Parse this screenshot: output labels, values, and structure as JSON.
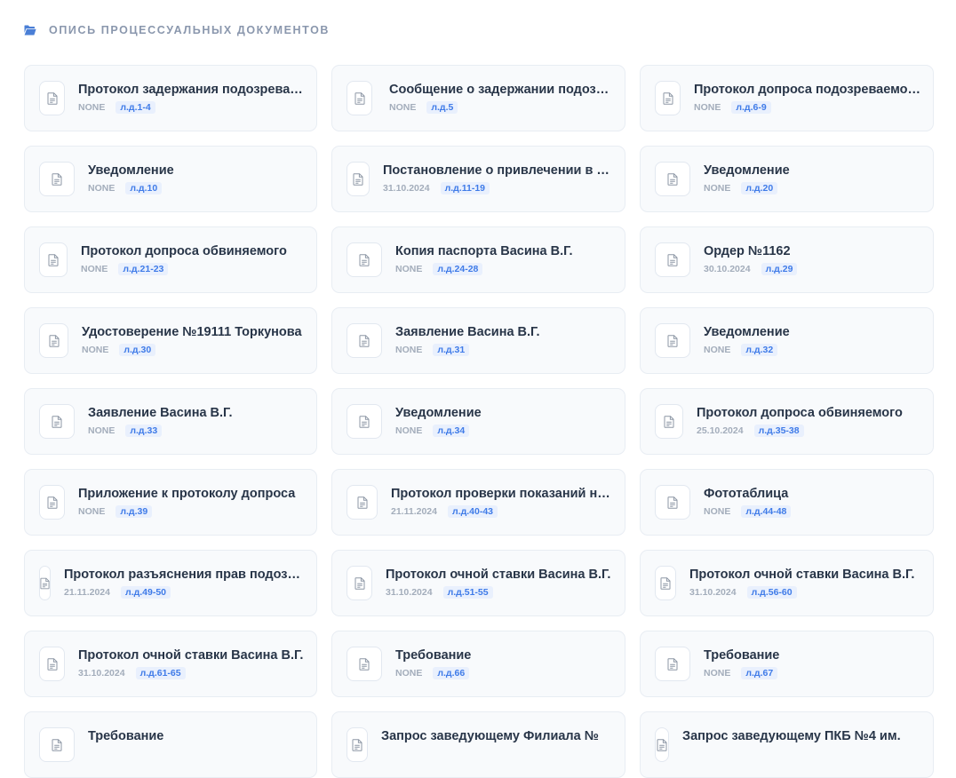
{
  "header": {
    "title": "ОПИСЬ ПРОЦЕССУАЛЬНЫХ ДОКУМЕНТОВ",
    "icon": "folder-open-icon",
    "icon_color": "#4a7fd6"
  },
  "colors": {
    "pages_text": "#3f7be8",
    "pages_bg": "#e9f0fd",
    "date_text": "#a3adbb",
    "title_text": "#283548"
  },
  "documents": [
    {
      "title": "Протокол задержания подозреваемого",
      "date": "NONE",
      "pages": "л.д.1-4",
      "icon": "document-icon"
    },
    {
      "title": "Сообщение о задержании подозреваемого",
      "date": "NONE",
      "pages": "л.д.5",
      "icon": "document-icon"
    },
    {
      "title": "Протокол допроса подозреваемого",
      "date": "NONE",
      "pages": "л.д.6-9",
      "icon": "document-icon"
    },
    {
      "title": "Уведомление",
      "date": "NONE",
      "pages": "л.д.10",
      "icon": "document-icon"
    },
    {
      "title": "Постановление о привлечении в качестве обвиняемого",
      "date": "31.10.2024",
      "pages": "л.д.11-19",
      "icon": "document-icon"
    },
    {
      "title": "Уведомление",
      "date": "NONE",
      "pages": "л.д.20",
      "icon": "document-icon"
    },
    {
      "title": "Протокол допроса обвиняемого",
      "date": "NONE",
      "pages": "л.д.21-23",
      "icon": "document-icon"
    },
    {
      "title": "Копия паспорта Васина В.Г.",
      "date": "NONE",
      "pages": "л.д.24-28",
      "icon": "document-icon"
    },
    {
      "title": "Ордер №1162",
      "date": "30.10.2024",
      "pages": "л.д.29",
      "icon": "document-icon"
    },
    {
      "title": "Удостоверение №19111 Торкунова",
      "date": "NONE",
      "pages": "л.д.30",
      "icon": "document-icon"
    },
    {
      "title": "Заявление Васина В.Г.",
      "date": "NONE",
      "pages": "л.д.31",
      "icon": "document-icon"
    },
    {
      "title": "Уведомление",
      "date": "NONE",
      "pages": "л.д.32",
      "icon": "document-icon"
    },
    {
      "title": "Заявление Васина В.Г.",
      "date": "NONE",
      "pages": "л.д.33",
      "icon": "document-icon"
    },
    {
      "title": "Уведомление",
      "date": "NONE",
      "pages": "л.д.34",
      "icon": "document-icon"
    },
    {
      "title": "Протокол допроса обвиняемого",
      "date": "25.10.2024",
      "pages": "л.д.35-38",
      "icon": "document-icon"
    },
    {
      "title": "Приложение к протоколу допроса",
      "date": "NONE",
      "pages": "л.д.39",
      "icon": "document-icon"
    },
    {
      "title": "Протокол проверки показаний на месте",
      "date": "21.11.2024",
      "pages": "л.д.40-43",
      "icon": "document-icon"
    },
    {
      "title": "Фототаблица",
      "date": "NONE",
      "pages": "л.д.44-48",
      "icon": "document-icon"
    },
    {
      "title": "Протокол разъяснения прав подозреваемому",
      "date": "21.11.2024",
      "pages": "л.д.49-50",
      "icon": "document-icon"
    },
    {
      "title": "Протокол очной ставки Васина В.Г.",
      "date": "31.10.2024",
      "pages": "л.д.51-55",
      "icon": "document-icon"
    },
    {
      "title": "Протокол очной ставки Васина В.Г.",
      "date": "31.10.2024",
      "pages": "л.д.56-60",
      "icon": "document-icon"
    },
    {
      "title": "Протокол очной ставки Васина В.Г.",
      "date": "31.10.2024",
      "pages": "л.д.61-65",
      "icon": "document-icon"
    },
    {
      "title": "Требование",
      "date": "NONE",
      "pages": "л.д.66",
      "icon": "document-icon"
    },
    {
      "title": "Требование",
      "date": "NONE",
      "pages": "л.д.67",
      "icon": "document-icon"
    },
    {
      "title": "Требование",
      "date": "",
      "pages": "",
      "icon": "document-icon"
    },
    {
      "title": "Запрос заведующему Филиала №",
      "date": "",
      "pages": "",
      "icon": "document-icon"
    },
    {
      "title": "Запрос заведующему ПКБ №4 им.",
      "date": "",
      "pages": "",
      "icon": "document-icon"
    }
  ]
}
